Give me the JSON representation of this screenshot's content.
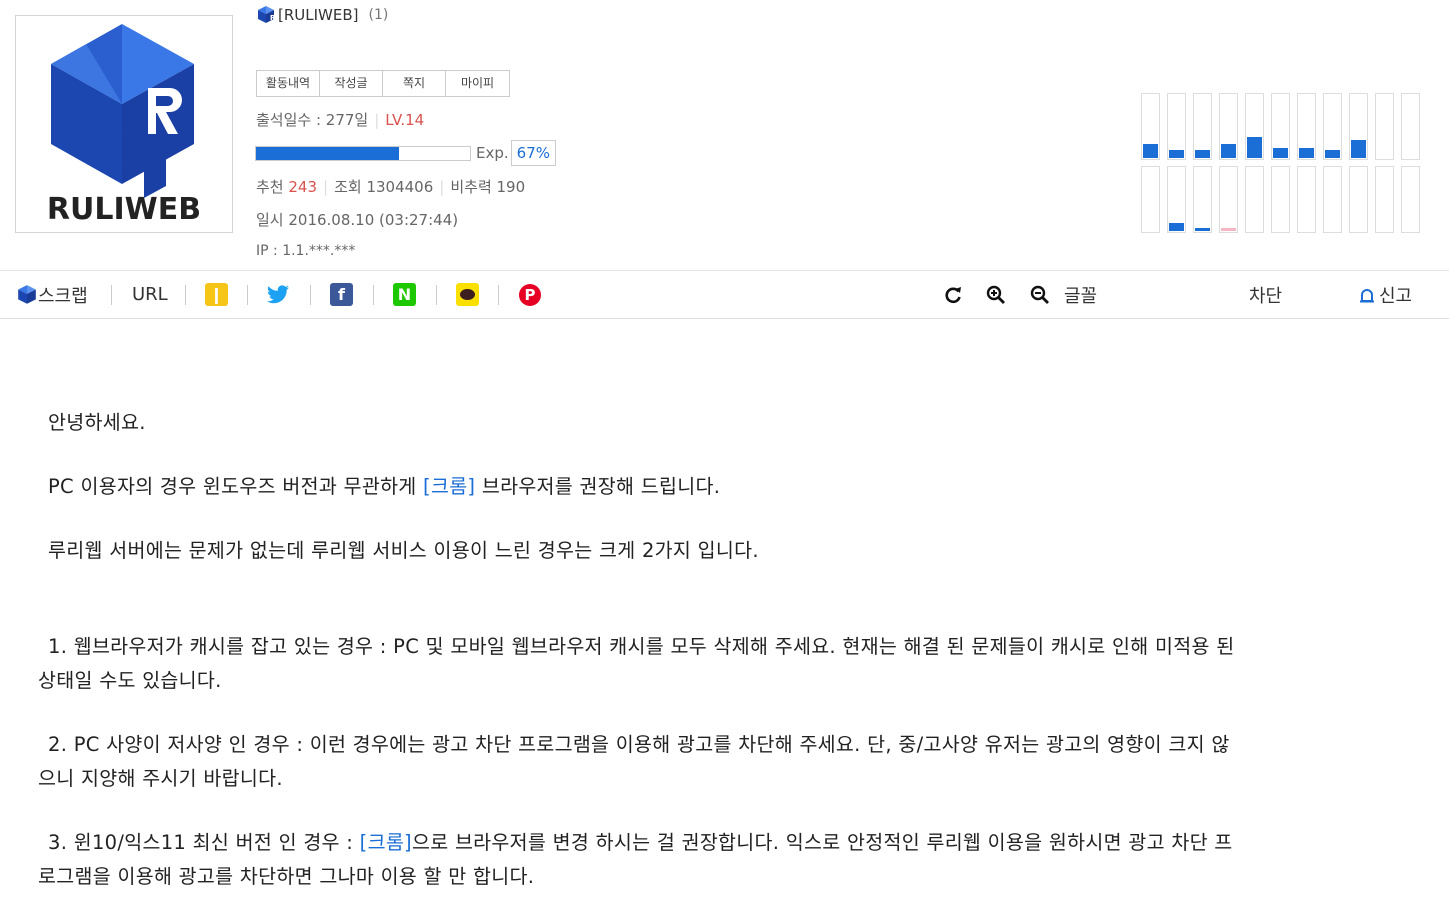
{
  "profile": {
    "nickname": "[RULIWEB]",
    "post_count": "(1)",
    "logo_text": "RULIWEB",
    "tabs": [
      "활동내역",
      "작성글",
      "쪽지",
      "마이피"
    ],
    "attendance": "출석일수 : 277일",
    "level": "LV.14",
    "exp_label": "Exp.",
    "exp_percent": "67%",
    "exp_fraction": 0.67,
    "recommend_label": "추천",
    "recommend_value": "243",
    "views": "조회 1304406",
    "nonrecommend": "비추력 190",
    "date": "일시 2016.08.10 (03:27:44)",
    "ip": "IP : 1.1.***.***"
  },
  "activity_graph": {
    "color_main": "#1a6ed6",
    "color_alt": "#f4b6c2",
    "top_row": [
      0.22,
      0.13,
      0.13,
      0.22,
      0.33,
      0.16,
      0.16,
      0.13,
      0.27,
      0,
      0
    ],
    "bottom_row": [
      0,
      0.13,
      0.05,
      0.05,
      0,
      0,
      0,
      0,
      0,
      0,
      0
    ]
  },
  "toolbar": {
    "scrap": "스크랩",
    "url": "URL",
    "font": "글꼴",
    "block": "차단",
    "report": "신고",
    "share_icons": [
      "kakaostory-icon",
      "twitter-icon",
      "facebook-icon",
      "naver-icon",
      "kakaotalk-icon",
      "pinterest-icon"
    ]
  },
  "article": {
    "greeting": "안녕하세요.",
    "p1_before": "PC 이용자의 경우 윈도우즈 버전과 무관하게 ",
    "p1_link": "[크롬]",
    "p1_after": " 브라우저를 권장해 드립니다.",
    "p2": "루리웹 서버에는 문제가 없는데 루리웹 서비스 이용이 느린 경우는 크게 2가지 입니다.",
    "item1_line1": "1. 웹브라우저가 캐시를 잡고 있는 경우 : PC 및 모바일 웹브라우저 캐시를 모두 삭제해 주세요. 현재는 해결 된 문제들이 캐시로 인해 미적용 된",
    "item1_line2": "상태일 수도 있습니다.",
    "item2_line1": "2. PC 사양이 저사양 인 경우 : 이런 경우에는 광고 차단 프로그램을 이용해 광고를 차단해 주세요. 단, 중/고사양 유저는 광고의 영향이 크지 않",
    "item2_line2": "으니 지양해 주시기 바랍니다.",
    "item3_before": "3. 윈10/익스11 최신 버전 인 경우 : ",
    "item3_link": "[크롬]",
    "item3_after": "으로 브라우저를 변경 하시는 걸 권장합니다. 익스로 안정적인 루리웹 이용을 원하시면 광고 차단 프",
    "item3_line2": "로그램을 이용해 광고를 차단하면 그나마 이용 할 만 합니다."
  }
}
